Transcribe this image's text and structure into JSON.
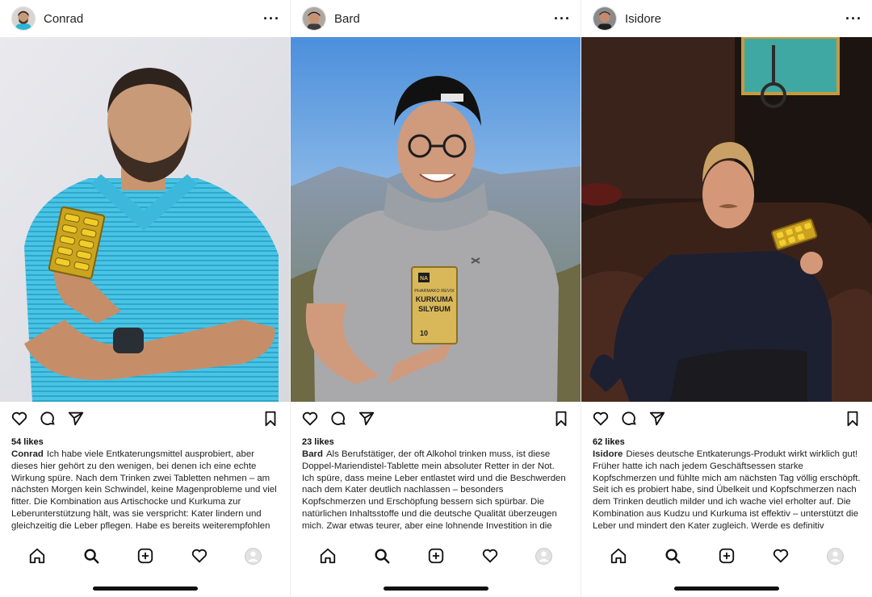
{
  "posts": [
    {
      "username": "Conrad",
      "avatar_icon": "avatar-bearded-man",
      "more_label": "···",
      "likes": "54 likes",
      "caption": "Ich habe viele Entkaterungsmittel ausprobiert, aber dieses hier gehört zu den wenigen, bei denen ich eine echte Wirkung spüre. Nach dem Trinken zwei Tabletten nehmen – am nächsten Morgen kein Schwindel, keine Magenprobleme und viel fitter. Die Kombination aus Artischocke und Kurkuma zur Leberunterstützung hält, was sie verspricht: Kater lindern und gleichzeitig die Leber pflegen. Habe es bereits weiterempfohlen und alle sind begeistert!"
    },
    {
      "username": "Bard",
      "avatar_icon": "avatar-man-cap",
      "more_label": "···",
      "likes": "23 likes",
      "caption": "Als Berufstätiger, der oft Alkohol trinken muss, ist diese Doppel-Mariendistel-Tablette mein absoluter Retter in der Not. Ich spüre, dass meine Leber entlastet wird und die Beschwerden nach dem Kater deutlich nachlassen – besonders Kopfschmerzen und Erschöpfung bessern sich spürbar. Die natürlichen Inhaltsstoffe und die deutsche Qualität überzeugen mich. Zwar etwas teurer, aber eine lohnende Investition in die Gesundheit!",
      "product_text": {
        "brand": "NA",
        "line1": "PHARMAKO REVIX",
        "line2": "KURKUMA",
        "line3": "SILYBUM",
        "count": "10"
      }
    },
    {
      "username": "Isidore",
      "avatar_icon": "avatar-man-dark",
      "more_label": "···",
      "likes": "62 likes",
      "caption": "Dieses deutsche Entkaterungs-Produkt wirkt wirklich gut! Früher hatte ich nach jedem Geschäftsessen starke Kopfschmerzen und fühlte mich am nächsten Tag völlig erschöpft. Seit ich es probiert habe, sind Übelkeit und Kopfschmerzen nach dem Trinken deutlich milder und ich wache viel erholter auf. Die Kombination aus Kudzu und Kurkuma ist effektiv – unterstützt die Leber und mindert den Kater zugleich. Werde es definitiv nachkaufen und empfehle"
    }
  ],
  "icons": {
    "like": "heart-outline-icon",
    "comment": "comment-bubble-icon",
    "share": "paper-plane-icon",
    "save": "bookmark-icon",
    "tab_home": "home-icon",
    "tab_search": "search-icon",
    "tab_create": "plus-square-icon",
    "tab_activity": "heart-icon",
    "tab_profile": "profile-avatar-icon"
  }
}
